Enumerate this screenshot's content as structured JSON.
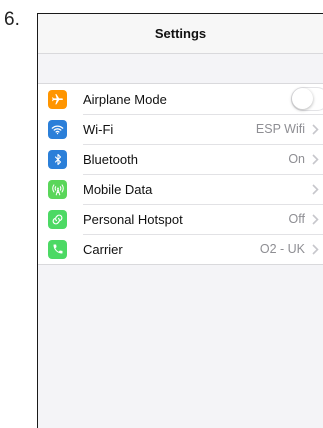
{
  "step_number": "6.",
  "navbar": {
    "title": "Settings"
  },
  "colors": {
    "airplane": "#ff9500",
    "wifi": "#2b7fd9",
    "bluetooth": "#2b7fd9",
    "mobile_data": "#5ad65a",
    "hotspot": "#4cd964",
    "carrier": "#4cd964"
  },
  "settings": [
    {
      "label": "Airplane Mode",
      "control": "toggle",
      "toggle_on": false,
      "icon": "airplane-icon"
    },
    {
      "label": "Wi-Fi",
      "value": "ESP Wifi",
      "icon": "wifi-icon"
    },
    {
      "label": "Bluetooth",
      "value": "On",
      "icon": "bluetooth-icon"
    },
    {
      "label": "Mobile Data",
      "value": "",
      "icon": "antenna-icon"
    },
    {
      "label": "Personal Hotspot",
      "value": "Off",
      "icon": "hotspot-link-icon"
    },
    {
      "label": "Carrier",
      "value": "O2 - UK",
      "icon": "phone-icon"
    }
  ]
}
